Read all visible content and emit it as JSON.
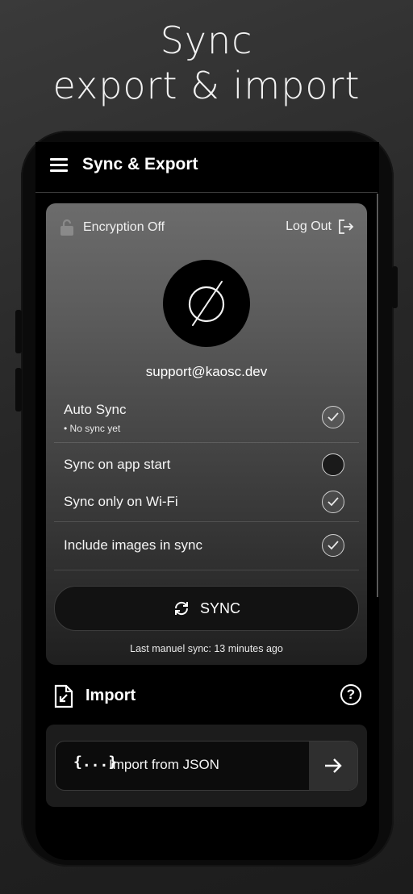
{
  "headline": {
    "line1": "Sync",
    "line2": "export & import"
  },
  "appbar": {
    "title": "Sync & Export"
  },
  "account": {
    "encryption_label": "Encryption Off",
    "logout_label": "Log Out",
    "email": "support@kaosc.dev"
  },
  "settings": [
    {
      "label": "Auto Sync",
      "sub": "• No sync yet",
      "checked": true
    },
    {
      "label": "Sync on app start",
      "checked": false
    },
    {
      "label": "Sync only on Wi-Fi",
      "checked": true
    },
    {
      "label": "Include images in sync",
      "checked": true
    }
  ],
  "sync": {
    "button_label": "SYNC",
    "last_sync": "Last manuel sync: 13 minutes ago"
  },
  "import": {
    "title": "Import",
    "json_label": "Import from JSON",
    "json_icon": "{...}"
  },
  "icons": {
    "menu": "hamburger-icon",
    "lock": "lock-open-icon",
    "logout": "logout-icon",
    "avatar": "empty-set-logo",
    "sync": "sync-icon",
    "import": "file-import-icon",
    "help": "help-circle-icon",
    "arrow": "arrow-right-icon"
  },
  "colors": {
    "background": "#262626",
    "phone": "#0b0b0b",
    "card_top": "#6c6c6c",
    "card_bottom": "#1f1f1f"
  }
}
